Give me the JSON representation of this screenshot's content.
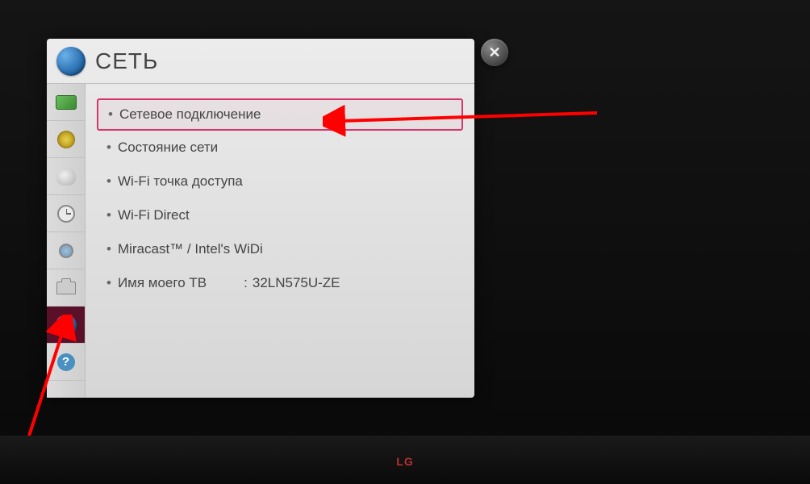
{
  "header": {
    "title": "СЕТЬ"
  },
  "close_button": {
    "label": "✕"
  },
  "sidebar": {
    "items": [
      {
        "name": "picture"
      },
      {
        "name": "sound"
      },
      {
        "name": "channel"
      },
      {
        "name": "time"
      },
      {
        "name": "lock"
      },
      {
        "name": "option"
      },
      {
        "name": "network",
        "active": true
      },
      {
        "name": "support"
      }
    ]
  },
  "menu": {
    "items": [
      {
        "label": "Сетевое подключение",
        "selected": true
      },
      {
        "label": "Состояние сети"
      },
      {
        "label": "Wi-Fi точка доступа"
      },
      {
        "label": "Wi-Fi Direct"
      },
      {
        "label": "Miracast™ / Intel's WiDi"
      },
      {
        "label": "Имя моего ТВ",
        "value": "32LN575U-ZE"
      }
    ]
  },
  "tv_brand": "LG",
  "annotations": {
    "arrow1": {
      "points_to": "menu.items.0"
    },
    "arrow2": {
      "points_to": "sidebar.items.6"
    }
  },
  "colors": {
    "highlight_border": "#d8356b",
    "sidebar_active_bg": "#5a1028",
    "annotation_arrow": "#ff0000"
  }
}
